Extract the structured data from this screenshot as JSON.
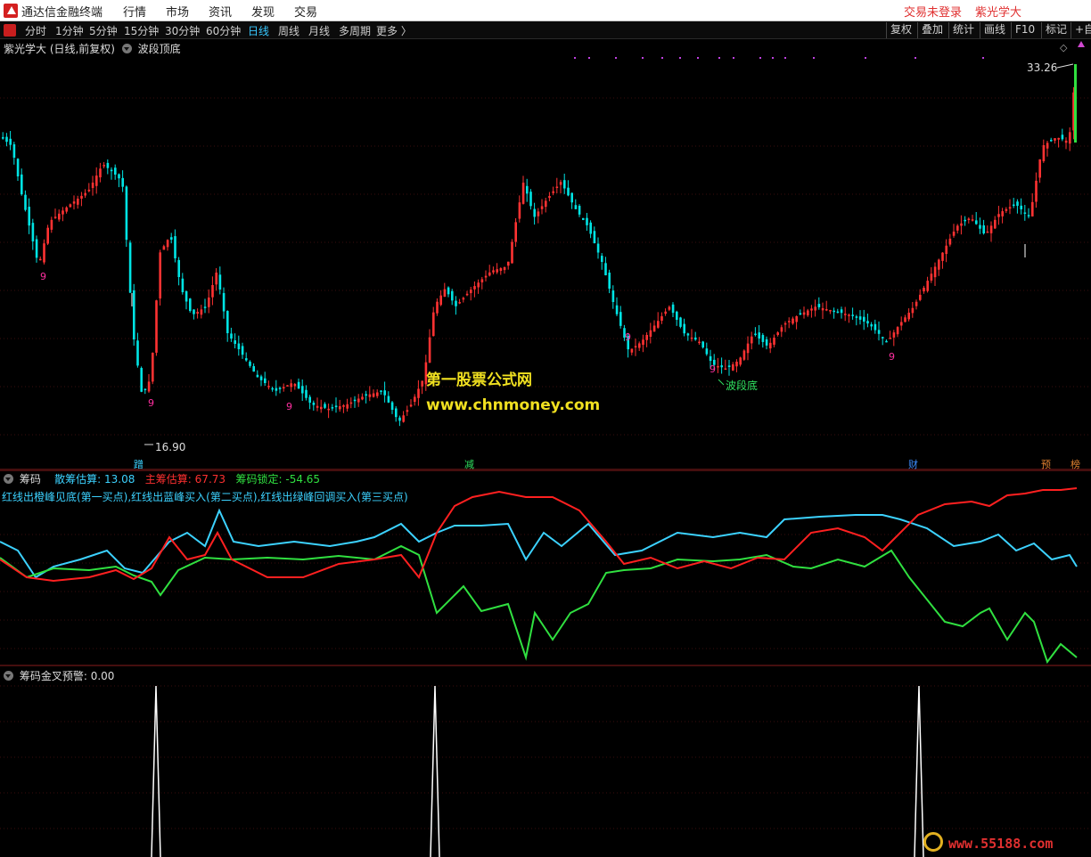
{
  "app": {
    "title": "通达信金融终端",
    "menu": [
      "行情",
      "市场",
      "资讯",
      "发现",
      "交易"
    ],
    "right_items": [
      "交易未登录",
      "紫光学大"
    ]
  },
  "toolbar": {
    "periods": [
      "分时",
      "1分钟",
      "5分钟",
      "15分钟",
      "30分钟",
      "60分钟",
      "日线",
      "周线",
      "月线",
      "多周期",
      "更多 〉"
    ],
    "active_period": "日线",
    "right_buttons": [
      "复权",
      "叠加",
      "统计",
      "画线",
      "F10",
      "标记",
      "+自"
    ]
  },
  "main_chart": {
    "title": "紫光学大 (日线,前复权)",
    "indicator": "波段顶底",
    "high_label": "33.26",
    "low_label": "16.90",
    "annotation": "波段底",
    "bottom_signal_digit": "9",
    "colors": {
      "up": "#ff3232",
      "down": "#00e4e4"
    },
    "watermark_title": "第一股票公式网",
    "watermark_url": "www.chnmoney.com"
  },
  "signals": [
    {
      "text": "蹭",
      "color": "#3cd2ff"
    },
    {
      "text": "减",
      "color": "#30e060"
    },
    {
      "text": "财",
      "color": "#3c8cff"
    },
    {
      "text": "预",
      "color": "#e08030"
    },
    {
      "text": "榜",
      "color": "#e08030"
    }
  ],
  "chip_panel": {
    "title": "筹码",
    "retail_label": "散筹估算:",
    "retail_value": "13.08",
    "main_label": "主筹估算:",
    "main_value": "67.73",
    "lock_label": "筹码锁定:",
    "lock_value": "-54.65",
    "legend": "红线出橙峰见底(第一买点),红线出蓝峰买入(第二买点),红线出绿峰回调买入(第三买点)",
    "colors": {
      "retail": "#3cd2ff",
      "main": "#ff2020",
      "lock": "#30e040"
    }
  },
  "cross_panel": {
    "title": "筹码金叉预警",
    "value": ": 0.00"
  },
  "site_logo": {
    "text": "www.55188.com"
  }
}
